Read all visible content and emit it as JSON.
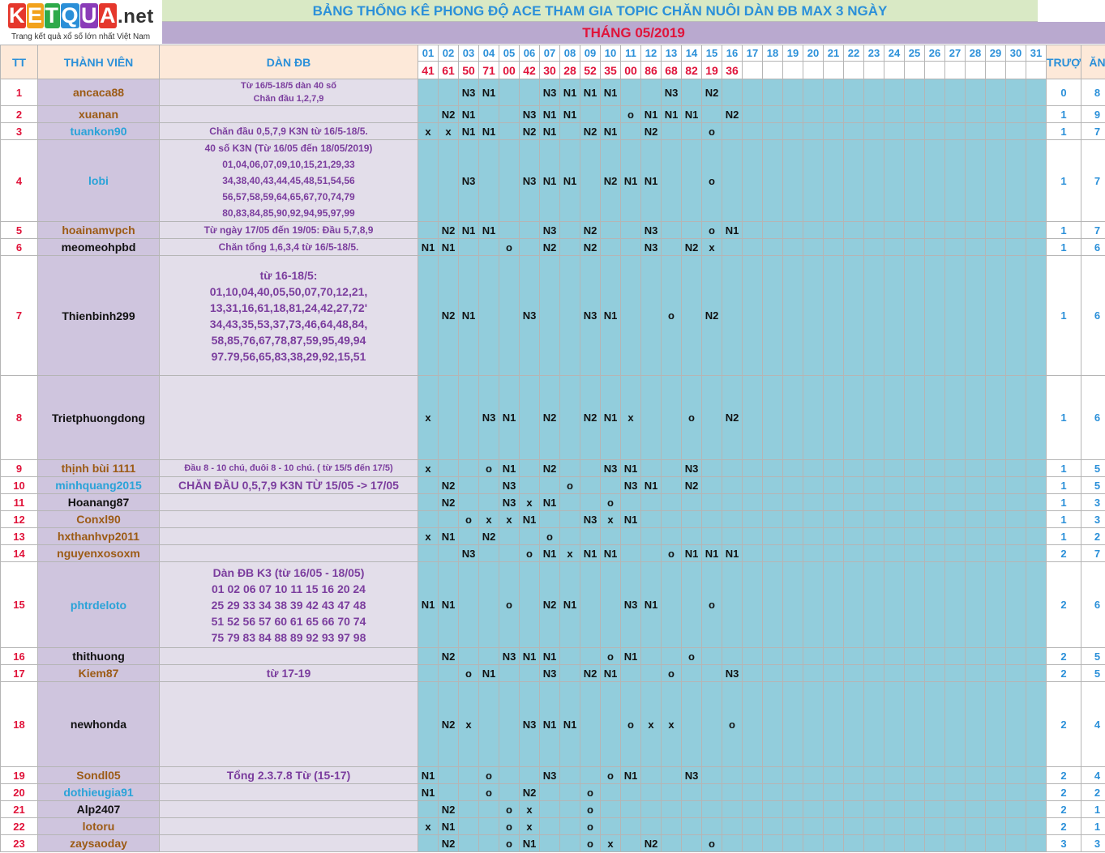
{
  "logo": {
    "letters": [
      "K",
      "E",
      "T",
      "Q",
      "U",
      "A"
    ],
    "colors": [
      "#e5372c",
      "#f2a21c",
      "#2eaa4a",
      "#2b8fd8",
      "#8a3cb8",
      "#e5372c"
    ],
    "suffix": ".net",
    "tagline": "Trang kết quả xổ số lớn nhất Việt Nam"
  },
  "title": "BẢNG THỐNG KÊ PHONG ĐỘ ACE THAM GIA TOPIC CHĂN NUÔI DÀN ĐB MAX 3 NGÀY",
  "month": "THÁNG 05/2019",
  "headers": {
    "tt": "TT",
    "member": "THÀNH VIÊN",
    "dan": "DÀN ĐB",
    "truot": "TRƯỢT",
    "an": "ĂN"
  },
  "days": [
    "01",
    "02",
    "03",
    "04",
    "05",
    "06",
    "07",
    "08",
    "09",
    "10",
    "11",
    "12",
    "13",
    "14",
    "15",
    "16",
    "17",
    "18",
    "19",
    "20",
    "21",
    "22",
    "23",
    "24",
    "25",
    "26",
    "27",
    "28",
    "29",
    "30",
    "31"
  ],
  "results": [
    "41",
    "61",
    "50",
    "71",
    "00",
    "42",
    "30",
    "28",
    "52",
    "35",
    "00",
    "86",
    "68",
    "82",
    "19",
    "36",
    "",
    "",
    "",
    "",
    "",
    "",
    "",
    "",
    "",
    "",
    "",
    "",
    "",
    "",
    ""
  ],
  "rows": [
    {
      "tt": "1",
      "name": "ancaca88",
      "color": "#9c5b15",
      "dan": [
        "Từ 16/5-18/5 dàn 40 số",
        "Chăn đầu 1,2,7,9"
      ],
      "dan_size": "small",
      "h": 20,
      "cells": {
        "3": "N3",
        "4": "N1",
        "7": "N3",
        "8": "N1",
        "9": "N1",
        "10": "N1",
        "13": "N3",
        "15": "N2"
      },
      "truot": "0",
      "an": "8"
    },
    {
      "tt": "2",
      "name": "xuanan",
      "color": "#9c5b15",
      "dan": [],
      "h": 21,
      "cells": {
        "2": "N2",
        "3": "N1",
        "6": "N3",
        "7": "N1",
        "8": "N1",
        "11": "o",
        "12": "N1",
        "13": "N1",
        "14": "N1",
        "16": "N2"
      },
      "truot": "1",
      "an": "9"
    },
    {
      "tt": "3",
      "name": "tuankon90",
      "color": "#2aa3d8",
      "dan": [
        "Chăn đầu 0,5,7,9 K3N từ 16/5-18/5."
      ],
      "h": 21,
      "cells": {
        "1": "x",
        "2": "x",
        "3": "N1",
        "4": "N1",
        "6": "N2",
        "7": "N1",
        "9": "N2",
        "10": "N1",
        "12": "N2",
        "15": "o"
      },
      "truot": "1",
      "an": "7"
    },
    {
      "tt": "4",
      "name": "lobi",
      "color": "#2aa3d8",
      "dan": [
        "40 số K3N (Từ 16/05 đến 18/05/2019)",
        "01,04,06,07,09,10,15,21,29,33",
        "34,38,40,43,44,45,48,51,54,56",
        "56,57,58,59,64,65,67,70,74,79",
        "80,83,84,85,90,92,94,95,97,99"
      ],
      "h": 100,
      "cells": {
        "3": "N3",
        "6": "N3",
        "7": "N1",
        "8": "N1",
        "10": "N2",
        "11": "N1",
        "12": "N1",
        "15": "o"
      },
      "truot": "1",
      "an": "7"
    },
    {
      "tt": "5",
      "name": "hoainamvpch",
      "color": "#9c5b15",
      "dan": [
        "Từ ngày 17/05 đến 19/05: Đầu 5,7,8,9"
      ],
      "h": 21,
      "cells": {
        "2": "N2",
        "3": "N1",
        "4": "N1",
        "7": "N3",
        "9": "N2",
        "12": "N3",
        "15": "o",
        "16": "N1"
      },
      "truot": "1",
      "an": "7"
    },
    {
      "tt": "6",
      "name": "meomeohpbd",
      "color": "#111111",
      "dan": [
        "Chăn tổng 1,6,3,4 từ 16/5-18/5."
      ],
      "h": 21,
      "cells": {
        "1": "N1",
        "2": "N1",
        "5": "o",
        "7": "N2",
        "9": "N2",
        "12": "N3",
        "14": "N2",
        "15": "x"
      },
      "truot": "1",
      "an": "6"
    },
    {
      "tt": "7",
      "name": "Thienbinh299",
      "color": "#111111",
      "dan": [
        "từ 16-18/5:",
        "01,10,04,40,05,50,07,70,12,21,",
        "13,31,16,61,18,81,24,42,27,72'",
        "34,43,35,53,37,73,46,64,48,84,",
        "58,85,76,67,78,87,59,95,49,94",
        "97.79,56,65,83,38,29,92,15,51"
      ],
      "dan_size": "big",
      "h": 148,
      "cells": {
        "2": "N2",
        "3": "N1",
        "6": "N3",
        "9": "N3",
        "10": "N1",
        "13": "o",
        "15": "N2"
      },
      "truot": "1",
      "an": "6"
    },
    {
      "tt": "8",
      "name": "Trietphuongdong",
      "color": "#111111",
      "dan": [],
      "h": 104,
      "cells": {
        "1": "x",
        "4": "N3",
        "5": "N1",
        "7": "N2",
        "9": "N2",
        "10": "N1",
        "11": "x",
        "14": "o",
        "16": "N2"
      },
      "truot": "1",
      "an": "6"
    },
    {
      "tt": "9",
      "name": "thịnh bùi 1111",
      "color": "#9c5b15",
      "dan": [
        "Đầu 8 - 10 chú, đuôi 8 - 10 chú. ( từ 15/5 đến 17/5)"
      ],
      "dan_size": "small",
      "h": 21,
      "cells": {
        "1": "x",
        "4": "o",
        "5": "N1",
        "7": "N2",
        "10": "N3",
        "11": "N1",
        "14": "N3"
      },
      "truot": "1",
      "an": "5"
    },
    {
      "tt": "10",
      "name": "minhquang2015",
      "color": "#2aa3d8",
      "dan": [
        "CHĂN ĐẦU 0,5,7,9 K3N TỪ 15/05 -> 17/05"
      ],
      "dan_size": "big",
      "h": 21,
      "cells": {
        "2": "N2",
        "5": "N3",
        "8": "o",
        "11": "N3",
        "12": "N1",
        "14": "N2"
      },
      "truot": "1",
      "an": "5"
    },
    {
      "tt": "11",
      "name": "Hoanang87",
      "color": "#111111",
      "dan": [],
      "h": 21,
      "cells": {
        "2": "N2",
        "5": "N3",
        "6": "x",
        "7": "N1",
        "10": "o"
      },
      "truot": "1",
      "an": "3"
    },
    {
      "tt": "12",
      "name": "Conxl90",
      "color": "#9c5b15",
      "dan": [],
      "h": 21,
      "cells": {
        "3": "o",
        "4": "x",
        "5": "x",
        "6": "N1",
        "9": "N3",
        "10": "x",
        "11": "N1"
      },
      "truot": "1",
      "an": "3"
    },
    {
      "tt": "13",
      "name": "hxthanhvp2011",
      "color": "#9c5b15",
      "dan": [],
      "h": 21,
      "cells": {
        "1": "x",
        "2": "N1",
        "4": "N2",
        "7": "o"
      },
      "truot": "1",
      "an": "2"
    },
    {
      "tt": "14",
      "name": "nguyenxosoxm",
      "color": "#9c5b15",
      "dan": [],
      "h": 21,
      "cells": {
        "3": "N3",
        "6": "o",
        "7": "N1",
        "8": "x",
        "9": "N1",
        "10": "N1",
        "13": "o",
        "14": "N1",
        "15": "N1",
        "16": "N1"
      },
      "truot": "2",
      "an": "7"
    },
    {
      "tt": "15",
      "name": "phtrdeloto",
      "color": "#2aa3d8",
      "dan": [
        "Dàn ĐB K3 (từ 16/05 - 18/05)",
        "01 02 06 07 10 11 15 16 20 24",
        "25 29 33 34 38 39 42 43 47 48",
        "51 52 56 57 60 61 65 66 70 74",
        "75 79 83 84 88 89 92 93 97 98"
      ],
      "dan_size": "big",
      "h": 106,
      "cells": {
        "1": "N1",
        "2": "N1",
        "5": "o",
        "7": "N2",
        "8": "N1",
        "11": "N3",
        "12": "N1",
        "15": "o"
      },
      "truot": "2",
      "an": "6"
    },
    {
      "tt": "16",
      "name": "thithuong",
      "color": "#111111",
      "dan": [],
      "h": 21,
      "cells": {
        "2": "N2",
        "5": "N3",
        "6": "N1",
        "7": "N1",
        "10": "o",
        "11": "N1",
        "14": "o"
      },
      "truot": "2",
      "an": "5"
    },
    {
      "tt": "17",
      "name": "Kiem87",
      "color": "#9c5b15",
      "dan": [
        "từ 17-19"
      ],
      "dan_size": "big",
      "h": 21,
      "cells": {
        "3": "o",
        "4": "N1",
        "7": "N3",
        "9": "N2",
        "10": "N1",
        "13": "o",
        "16": "N3"
      },
      "truot": "2",
      "an": "5"
    },
    {
      "tt": "18",
      "name": "newhonda",
      "color": "#111111",
      "dan": [],
      "h": 105,
      "cells": {
        "2": "N2",
        "3": "x",
        "6": "N3",
        "7": "N1",
        "8": "N1",
        "11": "o",
        "12": "x",
        "13": "x",
        "16": "o"
      },
      "truot": "2",
      "an": "4"
    },
    {
      "tt": "19",
      "name": "Sondl05",
      "color": "#9c5b15",
      "dan": [
        "Tổng 2.3.7.8 Từ (15-17)"
      ],
      "dan_size": "big",
      "h": 21,
      "cells": {
        "1": "N1",
        "4": "o",
        "7": "N3",
        "10": "o",
        "11": "N1",
        "14": "N3"
      },
      "truot": "2",
      "an": "4"
    },
    {
      "tt": "20",
      "name": "dothieugia91",
      "color": "#2aa3d8",
      "dan": [],
      "h": 21,
      "cells": {
        "1": "N1",
        "4": "o",
        "6": "N2",
        "9": "o"
      },
      "truot": "2",
      "an": "2"
    },
    {
      "tt": "21",
      "name": "Alp2407",
      "color": "#111111",
      "dan": [],
      "h": 21,
      "cells": {
        "2": "N2",
        "5": "o",
        "6": "x",
        "9": "o"
      },
      "truot": "2",
      "an": "1"
    },
    {
      "tt": "22",
      "name": "lotoru",
      "color": "#9c5b15",
      "dan": [],
      "h": 21,
      "cells": {
        "1": "x",
        "2": "N1",
        "5": "o",
        "6": "x",
        "9": "o"
      },
      "truot": "2",
      "an": "1"
    },
    {
      "tt": "23",
      "name": "zaysaoday",
      "color": "#9c5b15",
      "dan": [],
      "h": 21,
      "cells": {
        "2": "N2",
        "5": "o",
        "6": "N1",
        "9": "o",
        "10": "x",
        "12": "N2",
        "15": "o"
      },
      "truot": "3",
      "an": "3"
    }
  ]
}
